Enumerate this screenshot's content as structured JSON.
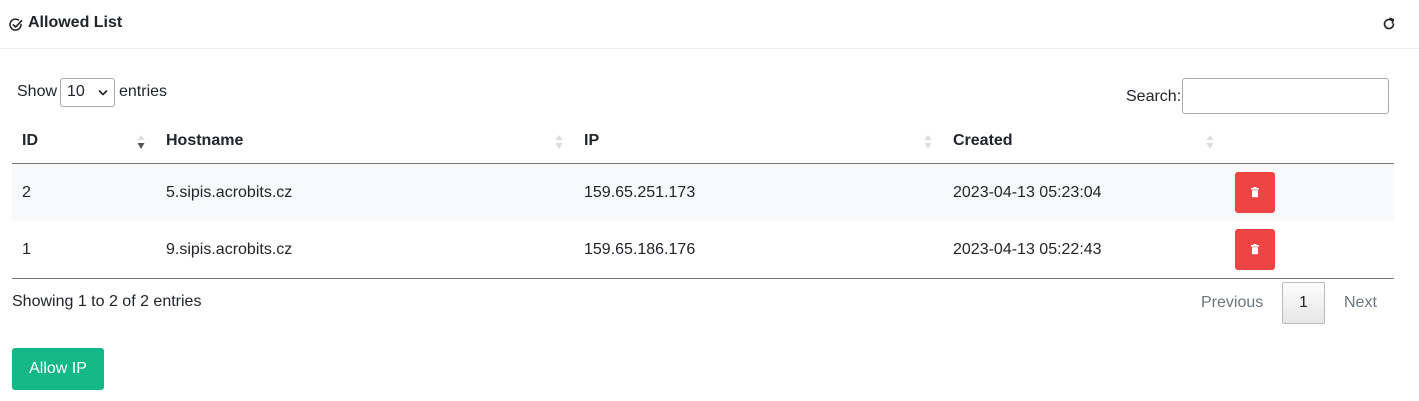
{
  "header": {
    "title": "Allowed List",
    "icon": "check-circle-icon",
    "refresh_icon": "refresh-icon"
  },
  "controls": {
    "show_label": "Show",
    "page_length": "10",
    "entries_label": "entries",
    "search_label": "Search:",
    "search_value": ""
  },
  "table": {
    "columns": [
      "ID",
      "Hostname",
      "IP",
      "Created"
    ],
    "sorted_column": "ID",
    "sort_direction": "descending",
    "rows": [
      {
        "id": "2",
        "hostname": "5.sipis.acrobits.cz",
        "ip": "159.65.251.173",
        "created": "2023-04-13 05:23:04"
      },
      {
        "id": "1",
        "hostname": "9.sipis.acrobits.cz",
        "ip": "159.65.186.176",
        "created": "2023-04-13 05:22:43"
      }
    ],
    "delete_icon": "trash-icon"
  },
  "footer": {
    "info": "Showing 1 to 2 of 2 entries",
    "previous": "Previous",
    "current_page": "1",
    "next": "Next"
  },
  "actions": {
    "allow_ip": "Allow IP"
  },
  "colors": {
    "delete": "#ef4444",
    "allow": "#14b885"
  }
}
